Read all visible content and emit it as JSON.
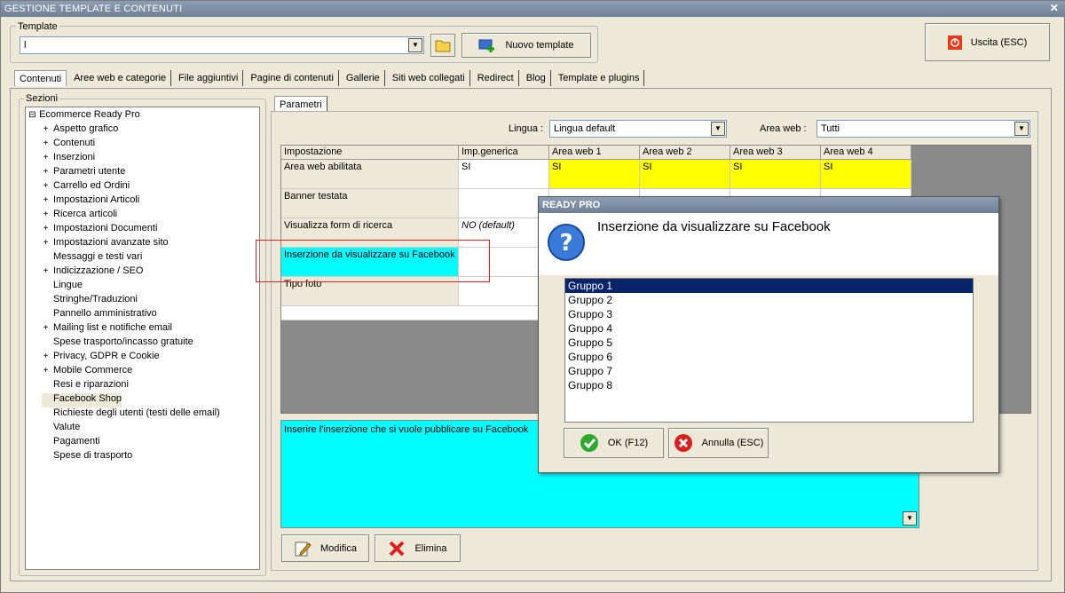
{
  "window": {
    "title": "GESTIONE TEMPLATE E CONTENUTI",
    "close": "✕"
  },
  "template": {
    "legend": "Template",
    "value": "l",
    "new_label": "Nuovo template"
  },
  "exit_label": "Uscita (ESC)",
  "tabs": [
    "Contenuti",
    "Aree web e categorie",
    "File aggiuntivi",
    "Pagine di contenuti",
    "Gallerie",
    "Siti web collegati",
    "Redirect",
    "Blog",
    "Template e plugins"
  ],
  "sections": {
    "legend": "Sezioni",
    "root": "Ecommerce Ready Pro",
    "items": [
      {
        "label": "Aspetto grafico",
        "exp": "+"
      },
      {
        "label": "Contenuti",
        "exp": "+"
      },
      {
        "label": "Inserzioni",
        "exp": "+"
      },
      {
        "label": "Parametri utente",
        "exp": "+"
      },
      {
        "label": "Carrello ed Ordini",
        "exp": "+"
      },
      {
        "label": "Impostazioni Articoli",
        "exp": "+"
      },
      {
        "label": "Ricerca articoli",
        "exp": "+"
      },
      {
        "label": "Impostazioni Documenti",
        "exp": "+"
      },
      {
        "label": "Impostazioni avanzate sito",
        "exp": "+"
      },
      {
        "label": "Messaggi e testi vari",
        "exp": ""
      },
      {
        "label": "Indicizzazione / SEO",
        "exp": "+"
      },
      {
        "label": "Lingue",
        "exp": ""
      },
      {
        "label": "Stringhe/Traduzioni",
        "exp": ""
      },
      {
        "label": "Pannello amministrativo",
        "exp": ""
      },
      {
        "label": "Mailing list e notifiche email",
        "exp": "+"
      },
      {
        "label": "Spese trasporto/incasso gratuite",
        "exp": ""
      },
      {
        "label": "Privacy, GDPR e Cookie",
        "exp": "+"
      },
      {
        "label": "Mobile Commerce",
        "exp": "+"
      },
      {
        "label": "Resi e riparazioni",
        "exp": ""
      },
      {
        "label": "Facebook Shop",
        "exp": ""
      },
      {
        "label": "Richieste degli utenti (testi delle email)",
        "exp": ""
      },
      {
        "label": "Valute",
        "exp": ""
      },
      {
        "label": "Pagamenti",
        "exp": ""
      },
      {
        "label": "Spese di trasporto",
        "exp": ""
      }
    ]
  },
  "params": {
    "tab": "Parametri",
    "lingua_label": "Lingua :",
    "lingua_value": "Lingua default",
    "area_label": "Area web :",
    "area_value": "Tutti"
  },
  "grid": {
    "headers": [
      "Impostazione",
      "Imp.generica",
      "Area web 1",
      "Area web 2",
      "Area web 3",
      "Area web 4"
    ],
    "rows": [
      [
        "Area web abilitata",
        "SI",
        "SI",
        "SI",
        "SI",
        "SI"
      ],
      [
        "Banner testata",
        "",
        "",
        "",
        "",
        ""
      ],
      [
        "Visualizza form di ricerca",
        "NO (default)",
        "",
        "",
        "",
        ""
      ],
      [
        "Inserzione da visualizzare su Facebook",
        "",
        "",
        "",
        "",
        ""
      ],
      [
        "Tipo foto",
        "",
        "",
        "",
        "",
        ""
      ]
    ]
  },
  "description": "Inserire l'inserzione che si vuole pubblicare su Facebook",
  "buttons": {
    "modifica": "Modifica",
    "elimina": "Elimina"
  },
  "dialog": {
    "title": "READY PRO",
    "question": "Inserzione da visualizzare su Facebook",
    "options": [
      "Gruppo 1",
      "Gruppo 2",
      "Gruppo 3",
      "Gruppo 4",
      "Gruppo 5",
      "Gruppo 6",
      "Gruppo 7",
      "Gruppo 8"
    ],
    "ok": "OK (F12)",
    "cancel": "Annulla (ESC)"
  },
  "colors": {
    "yellow": "#ffff00",
    "cyan": "#00ffff",
    "selected_row": "#0a246a",
    "highlight_box": "#e02020"
  }
}
